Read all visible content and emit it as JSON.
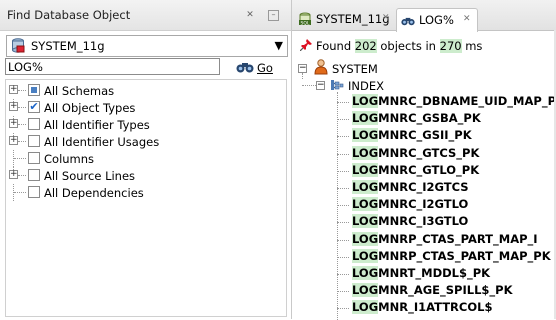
{
  "left_panel": {
    "title": "Find Database Object",
    "connection": "SYSTEM_11g",
    "search_value": "LOG%",
    "go_label": "Go",
    "options": [
      {
        "label": "All Schemas",
        "state": "partial",
        "expander": true
      },
      {
        "label": "All Object Types",
        "state": "checked",
        "expander": true
      },
      {
        "label": "All Identifier Types",
        "state": "unchecked",
        "expander": true
      },
      {
        "label": "All Identifier Usages",
        "state": "unchecked",
        "expander": true
      },
      {
        "label": "Columns",
        "state": "unchecked",
        "expander": false
      },
      {
        "label": "All Source Lines",
        "state": "unchecked",
        "expander": true
      },
      {
        "label": "All Dependencies",
        "state": "unchecked",
        "expander": false
      }
    ]
  },
  "tabs": [
    {
      "label": "SYSTEM_11g",
      "icon": "sql-worksheet-icon",
      "active": false
    },
    {
      "label": "LOG%",
      "icon": "binoculars-icon",
      "active": true
    }
  ],
  "results": {
    "found_prefix": "Found",
    "found_count": "202",
    "found_mid": "objects in",
    "found_ms": "270",
    "found_suffix": "ms",
    "schema": "SYSTEM",
    "object_type": "INDEX",
    "match_prefix": "LOG",
    "items": [
      "MNRC_DBNAME_UID_MAP_PK",
      "MNRC_GSBA_PK",
      "MNRC_GSII_PK",
      "MNRC_GTCS_PK",
      "MNRC_GTLO_PK",
      "MNRC_I2GTCS",
      "MNRC_I2GTLO",
      "MNRC_I3GTLO",
      "MNRP_CTAS_PART_MAP_I",
      "MNRP_CTAS_PART_MAP_PK",
      "MNRT_MDDL$_PK",
      "MNR_AGE_SPILL$_PK",
      "MNR_I1ATTRCOL$"
    ]
  },
  "colors": {
    "highlight": "#cdeccd",
    "accent_blue": "#1a64c8"
  }
}
